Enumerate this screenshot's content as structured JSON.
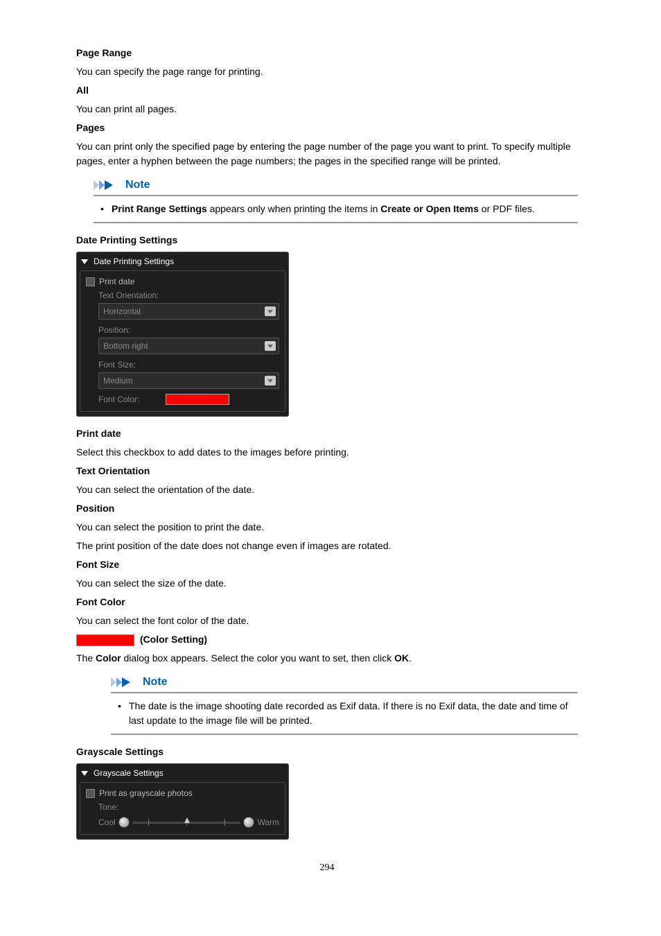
{
  "pageRange": {
    "title": "Page Range",
    "desc": "You can specify the page range for printing.",
    "all": {
      "title": "All",
      "desc": "You can print all pages."
    },
    "pages": {
      "title": "Pages",
      "desc": "You can print only the specified page by entering the page number of the page you want to print. To specify multiple pages, enter a hyphen between the page numbers; the pages in the specified range will be printed."
    }
  },
  "note1": {
    "heading": "Note",
    "prefix": "Print Range Settings",
    "mid": " appears only when printing the items in ",
    "bold2": "Create or Open Items",
    "suffix": " or PDF files."
  },
  "dps": {
    "title": "Date Printing Settings",
    "panel": {
      "header": "Date Printing Settings",
      "printDate": "Print date",
      "textOrientationLabel": "Text Orientation:",
      "textOrientationValue": "Horizontal",
      "positionLabel": "Position:",
      "positionValue": "Bottom right",
      "fontSizeLabel": "Font Size:",
      "fontSizeValue": "Medium",
      "fontColorLabel": "Font Color:"
    },
    "printDate": {
      "title": "Print date",
      "desc": "Select this checkbox to add dates to the images before printing."
    },
    "textOrientation": {
      "title": "Text Orientation",
      "desc": "You can select the orientation of the date."
    },
    "position": {
      "title": "Position",
      "desc1": "You can select the position to print the date.",
      "desc2": "The print position of the date does not change even if images are rotated."
    },
    "fontSize": {
      "title": "Font Size",
      "desc": "You can select the size of the date."
    },
    "fontColor": {
      "title": "Font Color",
      "desc": "You can select the font color of the date."
    },
    "colorSetting": {
      "label": " (Color Setting)",
      "descPrefix": "The ",
      "descBold1": "Color",
      "descMid": " dialog box appears. Select the color you want to set, then click ",
      "descBold2": "OK",
      "descSuffix": "."
    }
  },
  "note2": {
    "heading": "Note",
    "text": "The date is the image shooting date recorded as Exif data. If there is no Exif data, the date and time of last update to the image file will be printed."
  },
  "gs": {
    "title": "Grayscale Settings",
    "panel": {
      "header": "Grayscale Settings",
      "printGrayscale": "Print as grayscale photos",
      "toneLabel": "Tone:",
      "cool": "Cool",
      "warm": "Warm"
    }
  },
  "pageNumber": "294"
}
